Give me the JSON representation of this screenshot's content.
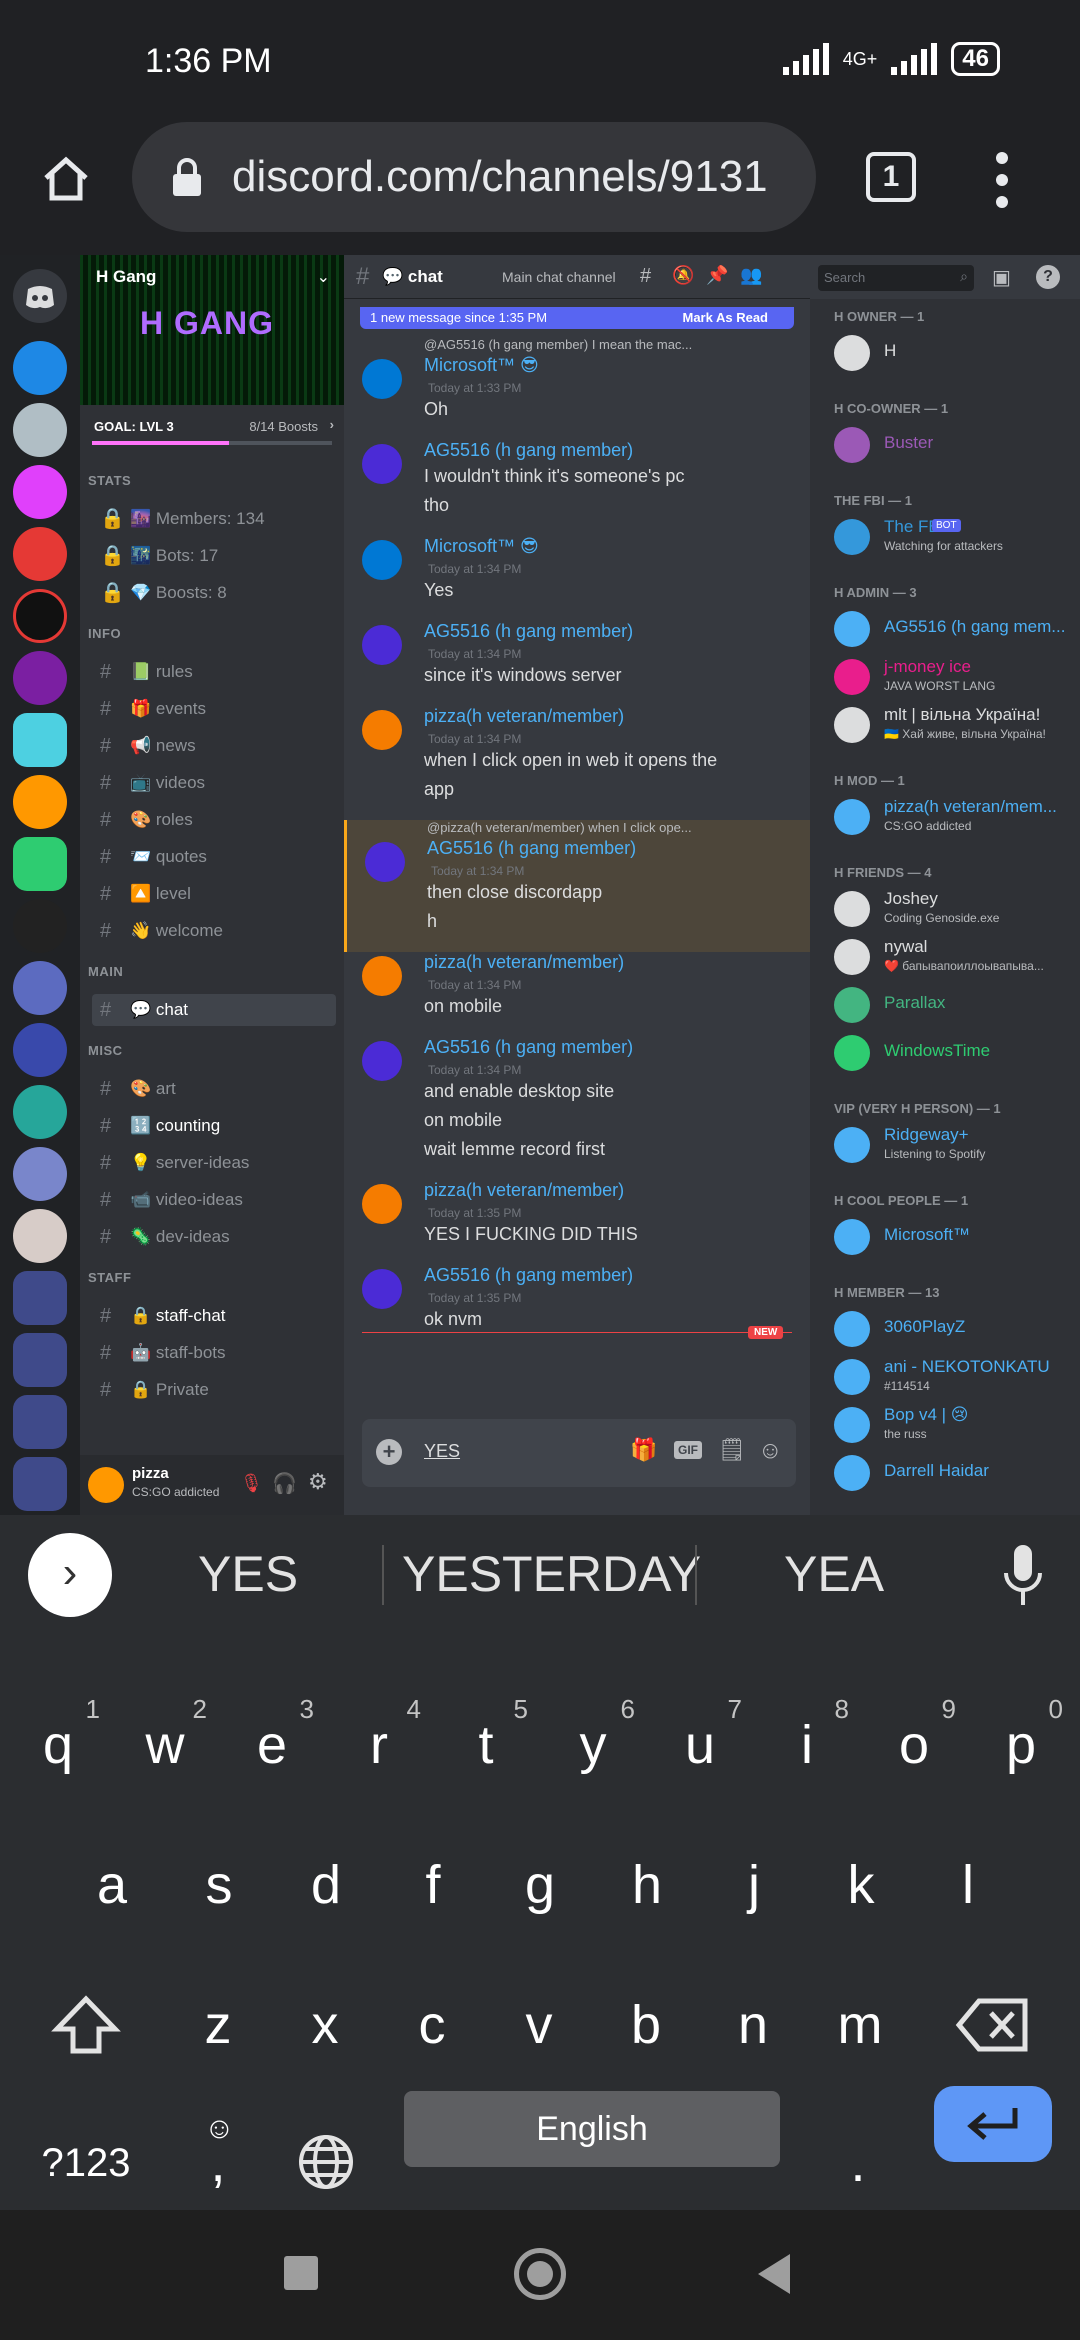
{
  "status": {
    "time": "1:36 PM",
    "network": "4G+",
    "battery": "46"
  },
  "browser": {
    "url": "discord.com/channels/9131",
    "tab_count": "1"
  },
  "server": {
    "name": "H Gang",
    "banner_text": "H GANG",
    "goal": "GOAL: LVL 3",
    "boosts": "8/14 Boosts",
    "goal_progress": 0.57
  },
  "channel_list": {
    "categories": [
      {
        "name": "STATS",
        "channels": [
          {
            "emoji": "🔒",
            "label": "🌆 Members: 134"
          },
          {
            "emoji": "🔒",
            "label": "🌃 Bots: 17"
          },
          {
            "emoji": "🔒",
            "label": "💎 Boosts: 8"
          }
        ]
      },
      {
        "name": "INFO",
        "channels": [
          {
            "label": "📗 rules"
          },
          {
            "label": "🎁 events"
          },
          {
            "label": "📢 news"
          },
          {
            "label": "📺 videos"
          },
          {
            "label": "🎨 roles"
          },
          {
            "label": "📨 quotes"
          },
          {
            "label": "🔼 level"
          },
          {
            "label": "👋 welcome"
          }
        ]
      },
      {
        "name": "MAIN",
        "channels": [
          {
            "label": "💬 chat"
          }
        ]
      },
      {
        "name": "MISC",
        "channels": [
          {
            "label": "🎨 art"
          },
          {
            "label": "🔢 counting"
          },
          {
            "label": "💡 server-ideas"
          },
          {
            "label": "📹 video-ideas"
          },
          {
            "label": "🦠 dev-ideas"
          }
        ]
      },
      {
        "name": "STAFF",
        "channels": [
          {
            "label": "🔒 staff-chat"
          },
          {
            "label": "🤖 staff-bots"
          },
          {
            "label": "🔒 Private"
          }
        ]
      }
    ]
  },
  "user": {
    "name": "pizza",
    "status": "CS:GO addicted"
  },
  "chat": {
    "channel": "💬 chat",
    "topic": "Main chat channel",
    "search_placeholder": "Search",
    "new_banner": "1 new message since 1:35 PM",
    "mark_read": "Mark As Read",
    "new_label": "NEW",
    "messages": [
      {
        "reply": "@AG5516 (h gang member)  I mean the mac...",
        "author": "Microsoft™ 😎",
        "time": "Today at 1:33 PM",
        "lines": [
          "Oh"
        ]
      },
      {
        "author": "AG5516 (h gang member)",
        "time": "",
        "lines": [
          "I wouldn't think it's someone's pc",
          "tho"
        ]
      },
      {
        "author": "Microsoft™ 😎",
        "time": "Today at 1:34 PM",
        "lines": [
          "Yes"
        ]
      },
      {
        "author": "AG5516 (h gang member)",
        "time": "Today at 1:34 PM",
        "lines": [
          "since it's windows server"
        ]
      },
      {
        "author": "pizza(h veteran/member)",
        "time": "Today at 1:34 PM",
        "lines": [
          "when I click open in web it opens the",
          "app"
        ]
      },
      {
        "reply": "@pizza(h veteran/member)  when I click ope...",
        "author": "AG5516 (h gang member)",
        "time": "Today at 1:34 PM",
        "lines": [
          "then close discordapp",
          "h"
        ]
      },
      {
        "author": "pizza(h veteran/member)",
        "time": "Today at 1:34 PM",
        "lines": [
          "on mobile"
        ]
      },
      {
        "author": "AG5516 (h gang member)",
        "time": "Today at 1:34 PM",
        "lines": [
          "and enable desktop site",
          "on mobile",
          "wait lemme record first"
        ]
      },
      {
        "author": "pizza(h veteran/member)",
        "time": "Today at 1:35 PM",
        "lines": [
          "YES I FUCKING DID THIS"
        ]
      },
      {
        "author": "AG5516 (h gang member)",
        "time": "Today at 1:35 PM",
        "lines": [
          "ok nvm"
        ]
      }
    ],
    "input_value": "YES"
  },
  "members": {
    "groups": [
      {
        "role": "H OWNER — 1",
        "members": [
          {
            "name": "H",
            "sub": "",
            "color": "#dcddde"
          }
        ]
      },
      {
        "role": "H CO-OWNER — 1",
        "members": [
          {
            "name": "Buster",
            "sub": "",
            "color": "#9b59b6"
          }
        ]
      },
      {
        "role": "THE FBI — 1",
        "members": [
          {
            "name": "The FBI",
            "sub": "Watching for attackers",
            "color": "#3498db",
            "bot": "BOT"
          }
        ]
      },
      {
        "role": "H ADMIN — 3",
        "members": [
          {
            "name": "AG5516 (h gang mem...",
            "sub": "",
            "color": "#4cb0f5"
          },
          {
            "name": "j-money ice",
            "sub": "JAVA WORST LANG",
            "color": "#e91e8c"
          },
          {
            "name": "mlt | вільна Україна!",
            "sub": "🇺🇦 Хай живе, вільна Україна!",
            "color": "#dcddde"
          }
        ]
      },
      {
        "role": "H MOD — 1",
        "members": [
          {
            "name": "pizza(h veteran/mem...",
            "sub": "CS:GO addicted",
            "color": "#4cb0f5"
          }
        ]
      },
      {
        "role": "H FRIENDS — 4",
        "members": [
          {
            "name": "Joshey",
            "sub": "Coding Genoside.exe",
            "color": "#dcddde"
          },
          {
            "name": "nywal",
            "sub": "❤️ бапывапоиллоывапыва...",
            "color": "#dcddde"
          },
          {
            "name": "Parallax",
            "sub": "",
            "color": "#43b581"
          },
          {
            "name": "WindowsTime",
            "sub": "",
            "color": "#2ecc71"
          }
        ]
      },
      {
        "role": "VIP (VERY H PERSON) — 1",
        "members": [
          {
            "name": "Ridgeway+",
            "sub": "Listening to Spotify",
            "color": "#4cb0f5"
          }
        ]
      },
      {
        "role": "H COOL PEOPLE — 1",
        "members": [
          {
            "name": "Microsoft™",
            "sub": "",
            "color": "#4cb0f5"
          }
        ]
      },
      {
        "role": "H MEMBER — 13",
        "members": [
          {
            "name": "3060PlayZ",
            "sub": "",
            "color": "#4cb0f5"
          },
          {
            "name": "ani - NEKOTONKATU",
            "sub": "#114514",
            "color": "#4cb0f5"
          },
          {
            "name": "Bop v4 | 😢",
            "sub": "the russ",
            "color": "#4cb0f5"
          },
          {
            "name": "Darrell Haidar",
            "sub": "",
            "color": "#4cb0f5"
          }
        ]
      }
    ]
  },
  "keyboard": {
    "suggestions": [
      "YES",
      "YESTERDAY",
      "YEA"
    ],
    "row1": [
      "q",
      "w",
      "e",
      "r",
      "t",
      "y",
      "u",
      "i",
      "o",
      "p"
    ],
    "row1_nums": [
      "1",
      "2",
      "3",
      "4",
      "5",
      "6",
      "7",
      "8",
      "9",
      "0"
    ],
    "row2": [
      "a",
      "s",
      "d",
      "f",
      "g",
      "h",
      "j",
      "k",
      "l"
    ],
    "row3": [
      "z",
      "x",
      "c",
      "v",
      "b",
      "n",
      "m"
    ],
    "sym": "?123",
    "comma": ",",
    "space": "English",
    "period": "."
  },
  "colors": {
    "blurple": "#5865f2",
    "link": "#4cb0f5"
  }
}
